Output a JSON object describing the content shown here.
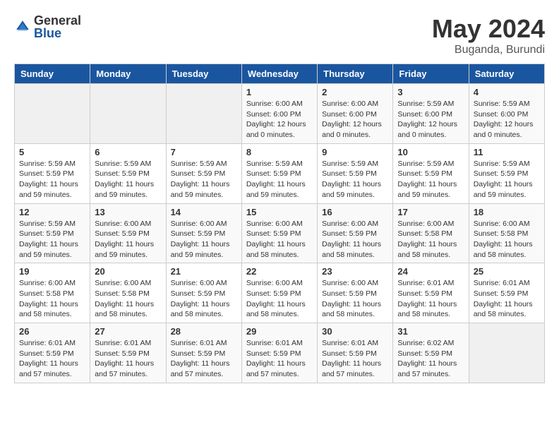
{
  "header": {
    "logo_general": "General",
    "logo_blue": "Blue",
    "month": "May 2024",
    "location": "Buganda, Burundi"
  },
  "weekdays": [
    "Sunday",
    "Monday",
    "Tuesday",
    "Wednesday",
    "Thursday",
    "Friday",
    "Saturday"
  ],
  "weeks": [
    [
      {
        "day": "",
        "info": ""
      },
      {
        "day": "",
        "info": ""
      },
      {
        "day": "",
        "info": ""
      },
      {
        "day": "1",
        "info": "Sunrise: 6:00 AM\nSunset: 6:00 PM\nDaylight: 12 hours\nand 0 minutes."
      },
      {
        "day": "2",
        "info": "Sunrise: 6:00 AM\nSunset: 6:00 PM\nDaylight: 12 hours\nand 0 minutes."
      },
      {
        "day": "3",
        "info": "Sunrise: 5:59 AM\nSunset: 6:00 PM\nDaylight: 12 hours\nand 0 minutes."
      },
      {
        "day": "4",
        "info": "Sunrise: 5:59 AM\nSunset: 6:00 PM\nDaylight: 12 hours\nand 0 minutes."
      }
    ],
    [
      {
        "day": "5",
        "info": "Sunrise: 5:59 AM\nSunset: 5:59 PM\nDaylight: 11 hours\nand 59 minutes."
      },
      {
        "day": "6",
        "info": "Sunrise: 5:59 AM\nSunset: 5:59 PM\nDaylight: 11 hours\nand 59 minutes."
      },
      {
        "day": "7",
        "info": "Sunrise: 5:59 AM\nSunset: 5:59 PM\nDaylight: 11 hours\nand 59 minutes."
      },
      {
        "day": "8",
        "info": "Sunrise: 5:59 AM\nSunset: 5:59 PM\nDaylight: 11 hours\nand 59 minutes."
      },
      {
        "day": "9",
        "info": "Sunrise: 5:59 AM\nSunset: 5:59 PM\nDaylight: 11 hours\nand 59 minutes."
      },
      {
        "day": "10",
        "info": "Sunrise: 5:59 AM\nSunset: 5:59 PM\nDaylight: 11 hours\nand 59 minutes."
      },
      {
        "day": "11",
        "info": "Sunrise: 5:59 AM\nSunset: 5:59 PM\nDaylight: 11 hours\nand 59 minutes."
      }
    ],
    [
      {
        "day": "12",
        "info": "Sunrise: 5:59 AM\nSunset: 5:59 PM\nDaylight: 11 hours\nand 59 minutes."
      },
      {
        "day": "13",
        "info": "Sunrise: 6:00 AM\nSunset: 5:59 PM\nDaylight: 11 hours\nand 59 minutes."
      },
      {
        "day": "14",
        "info": "Sunrise: 6:00 AM\nSunset: 5:59 PM\nDaylight: 11 hours\nand 59 minutes."
      },
      {
        "day": "15",
        "info": "Sunrise: 6:00 AM\nSunset: 5:59 PM\nDaylight: 11 hours\nand 58 minutes."
      },
      {
        "day": "16",
        "info": "Sunrise: 6:00 AM\nSunset: 5:59 PM\nDaylight: 11 hours\nand 58 minutes."
      },
      {
        "day": "17",
        "info": "Sunrise: 6:00 AM\nSunset: 5:58 PM\nDaylight: 11 hours\nand 58 minutes."
      },
      {
        "day": "18",
        "info": "Sunrise: 6:00 AM\nSunset: 5:58 PM\nDaylight: 11 hours\nand 58 minutes."
      }
    ],
    [
      {
        "day": "19",
        "info": "Sunrise: 6:00 AM\nSunset: 5:58 PM\nDaylight: 11 hours\nand 58 minutes."
      },
      {
        "day": "20",
        "info": "Sunrise: 6:00 AM\nSunset: 5:58 PM\nDaylight: 11 hours\nand 58 minutes."
      },
      {
        "day": "21",
        "info": "Sunrise: 6:00 AM\nSunset: 5:59 PM\nDaylight: 11 hours\nand 58 minutes."
      },
      {
        "day": "22",
        "info": "Sunrise: 6:00 AM\nSunset: 5:59 PM\nDaylight: 11 hours\nand 58 minutes."
      },
      {
        "day": "23",
        "info": "Sunrise: 6:00 AM\nSunset: 5:59 PM\nDaylight: 11 hours\nand 58 minutes."
      },
      {
        "day": "24",
        "info": "Sunrise: 6:01 AM\nSunset: 5:59 PM\nDaylight: 11 hours\nand 58 minutes."
      },
      {
        "day": "25",
        "info": "Sunrise: 6:01 AM\nSunset: 5:59 PM\nDaylight: 11 hours\nand 58 minutes."
      }
    ],
    [
      {
        "day": "26",
        "info": "Sunrise: 6:01 AM\nSunset: 5:59 PM\nDaylight: 11 hours\nand 57 minutes."
      },
      {
        "day": "27",
        "info": "Sunrise: 6:01 AM\nSunset: 5:59 PM\nDaylight: 11 hours\nand 57 minutes."
      },
      {
        "day": "28",
        "info": "Sunrise: 6:01 AM\nSunset: 5:59 PM\nDaylight: 11 hours\nand 57 minutes."
      },
      {
        "day": "29",
        "info": "Sunrise: 6:01 AM\nSunset: 5:59 PM\nDaylight: 11 hours\nand 57 minutes."
      },
      {
        "day": "30",
        "info": "Sunrise: 6:01 AM\nSunset: 5:59 PM\nDaylight: 11 hours\nand 57 minutes."
      },
      {
        "day": "31",
        "info": "Sunrise: 6:02 AM\nSunset: 5:59 PM\nDaylight: 11 hours\nand 57 minutes."
      },
      {
        "day": "",
        "info": ""
      }
    ]
  ]
}
